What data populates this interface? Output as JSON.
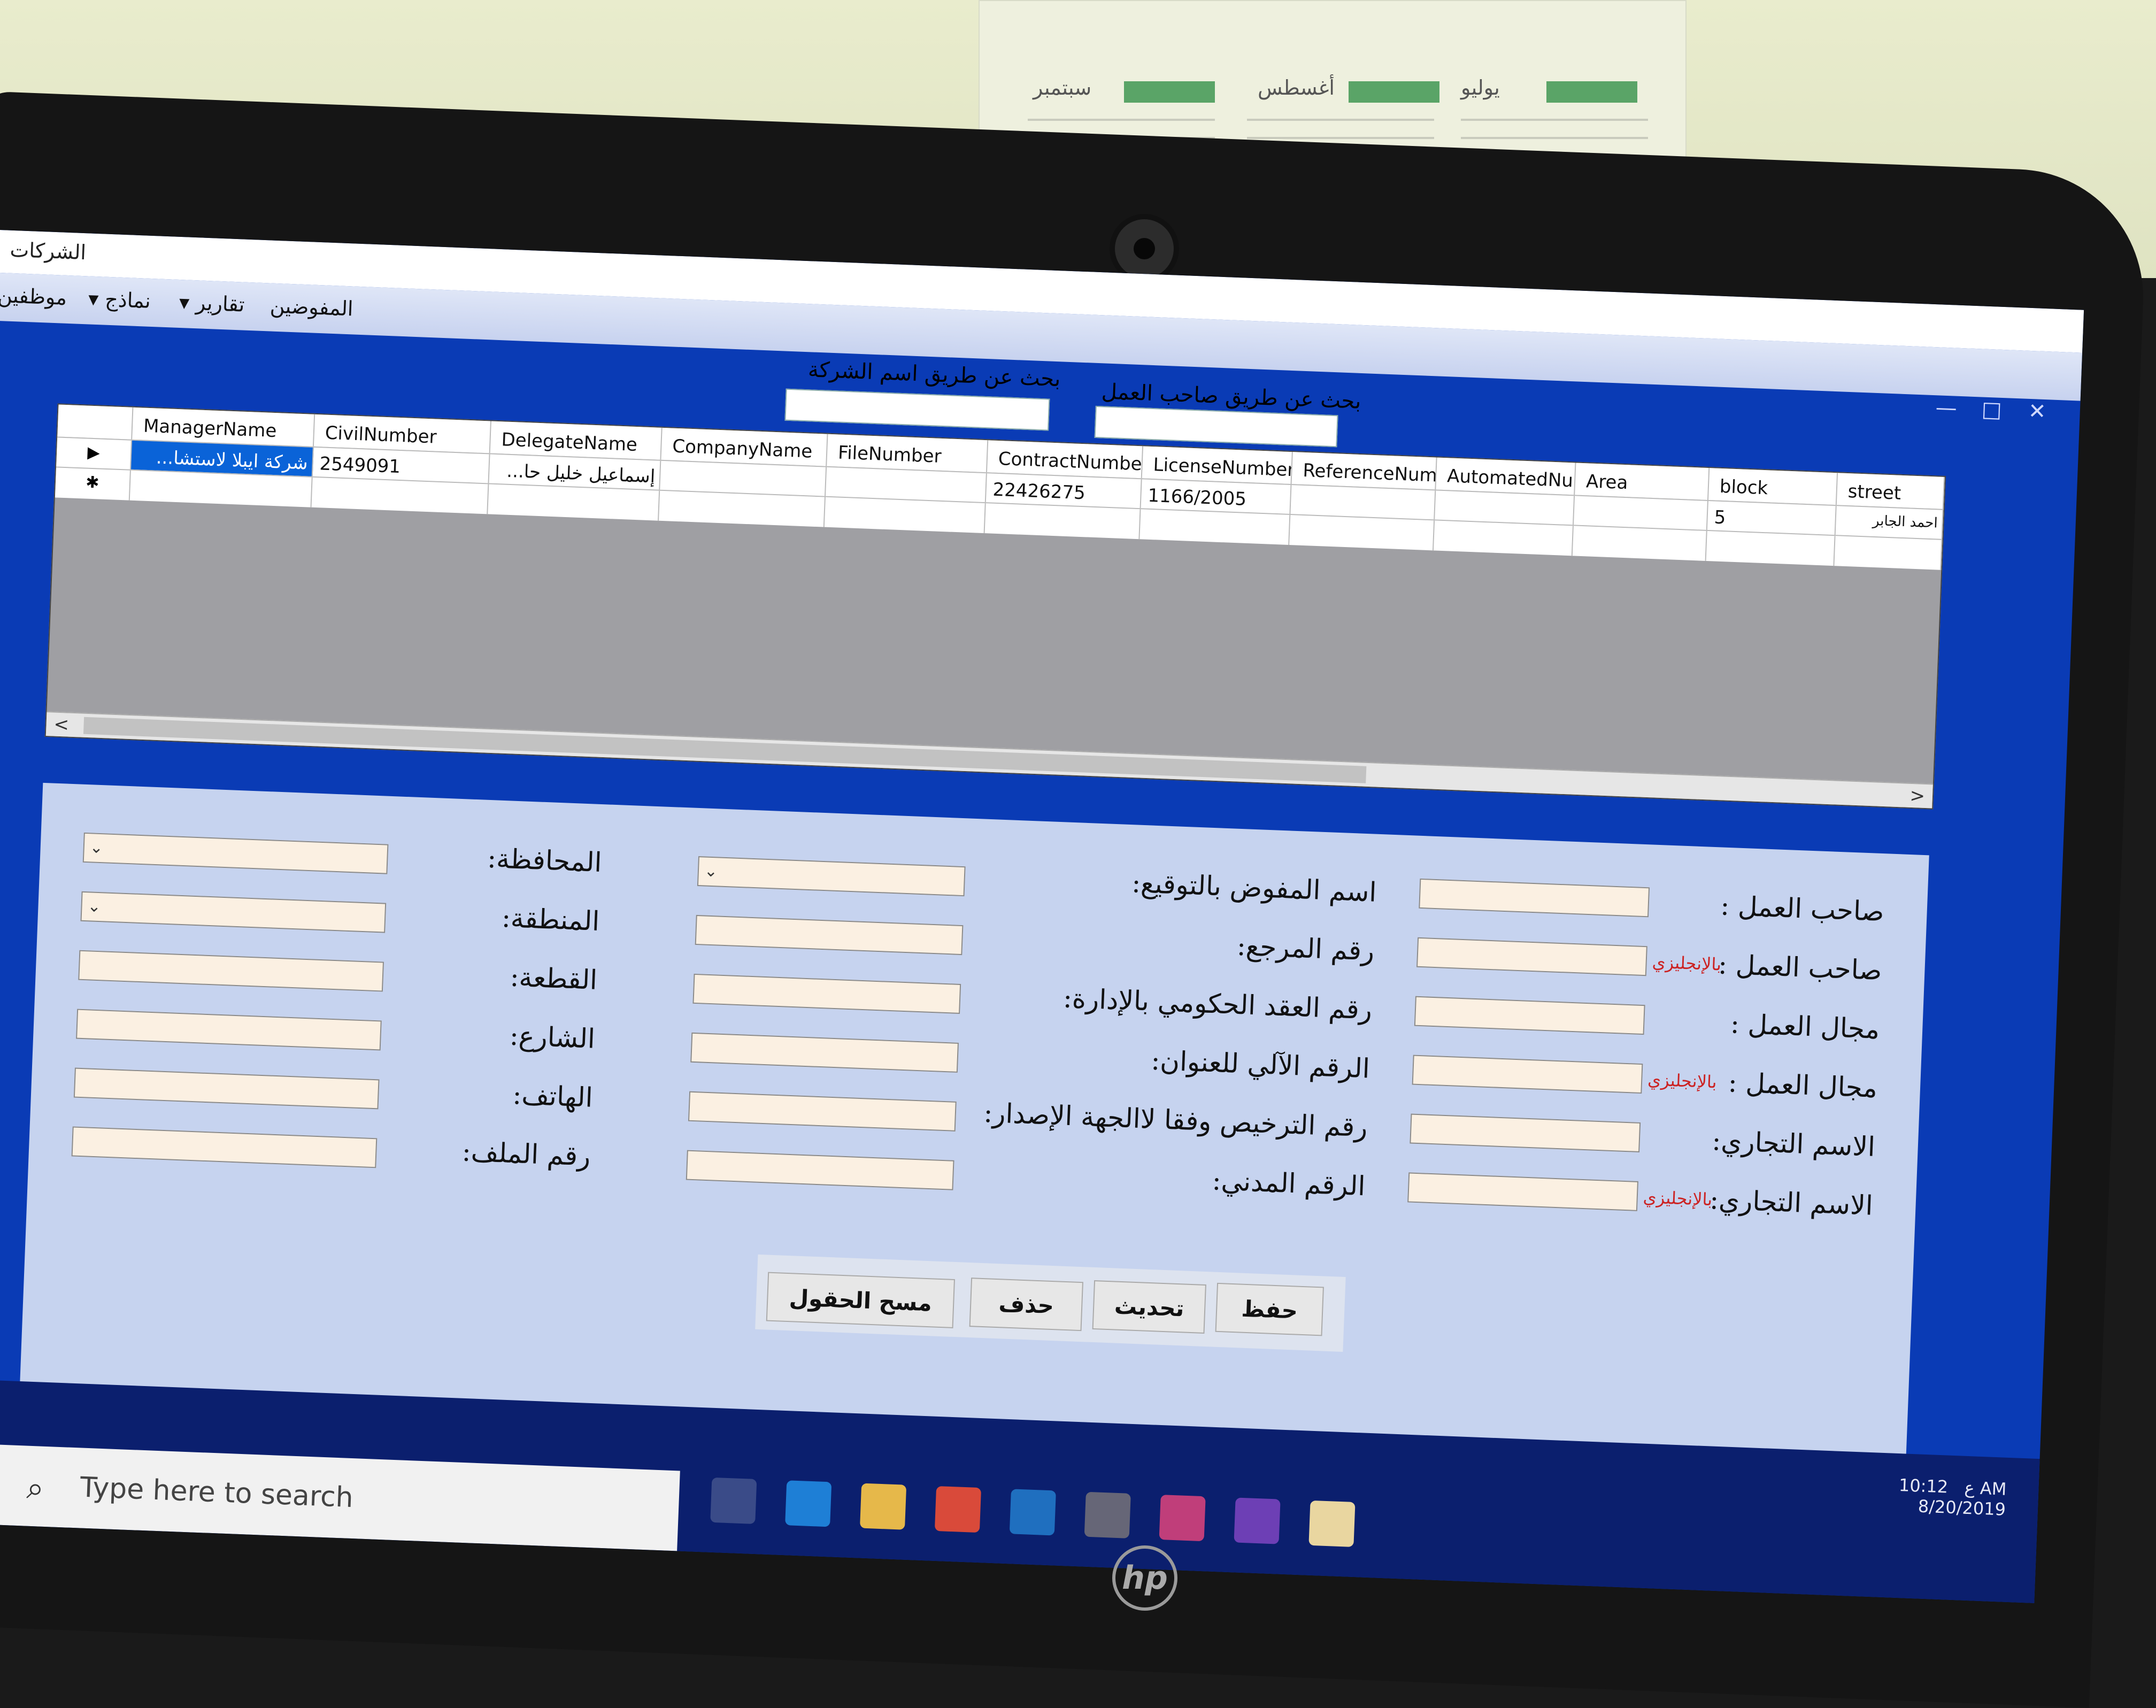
{
  "window": {
    "title": "الشركات",
    "controls": {
      "minimize": "—",
      "maximize": "□",
      "close": "✕"
    }
  },
  "menu": {
    "items": [
      "المفوضين",
      "تقارير ▾",
      "نماذج ▾",
      "موظفين"
    ]
  },
  "search": {
    "by_company_label": "بحث عن طريق اسم الشركة",
    "by_employer_label": "بحث عن طريق صاحب العمل",
    "by_company_value": "",
    "by_employer_value": ""
  },
  "grid": {
    "columns": [
      "ManagerName",
      "CivilNumber",
      "DelegateName",
      "CompanyName",
      "FileNumber",
      "ContractNumber",
      "LicenseNumber",
      "ReferenceNumber",
      "AutomatedNumber",
      "Area",
      "block",
      "street"
    ],
    "rows": [
      {
        "marker": "▶",
        "cells": [
          "شركة ايبلا لاستشا...",
          "2549091",
          "إسماعيل خليل حا...",
          "",
          "",
          "22426275",
          "1166/2005",
          "",
          "",
          "",
          "5",
          "احمد الجابر"
        ]
      },
      {
        "marker": "✱",
        "cells": [
          "",
          "",
          "",
          "",
          "",
          "",
          "",
          "",
          "",
          "",
          "",
          ""
        ]
      }
    ],
    "scroll_left": "<",
    "scroll_right": ">"
  },
  "form": {
    "right_labels": [
      {
        "text": "صاحب العمل :",
        "suffix": ""
      },
      {
        "text": "صاحب العمل :",
        "suffix": "بالإنجليزي"
      },
      {
        "text": "مجال العمل :",
        "suffix": ""
      },
      {
        "text": "مجال العمل :",
        "suffix": "بالإنجليزي"
      },
      {
        "text": "الاسم التجاري:",
        "suffix": ""
      },
      {
        "text": "الاسم التجاري:",
        "suffix": "بالإنجليزي"
      }
    ],
    "middle_labels": [
      "اسم المفوض بالتوقيع:",
      "رقم المرجع:",
      "رقم العقد الحكومي بالإدارة:",
      "الرقم الآلي للعنوان:",
      "رقم الترخيص وفقا لاالجهة الإصدار:",
      "الرقم المدني:"
    ],
    "left_labels": [
      "المحافظة:",
      "المنطقة:",
      "القطعة:",
      "الشارع:",
      "الهاتف:",
      "رقم الملف:"
    ],
    "buttons": {
      "save": "حفظ",
      "update": "تحديث",
      "delete": "حذف",
      "clear": "مسح الحقول"
    }
  },
  "taskbar": {
    "search_placeholder": "Type here to search",
    "time": "10:12 AM",
    "date": "8/20/2019",
    "lang": "ع"
  },
  "calendar": {
    "months": [
      "سبتمبر",
      "أغسطس",
      "يوليو"
    ]
  },
  "brand": "hp"
}
